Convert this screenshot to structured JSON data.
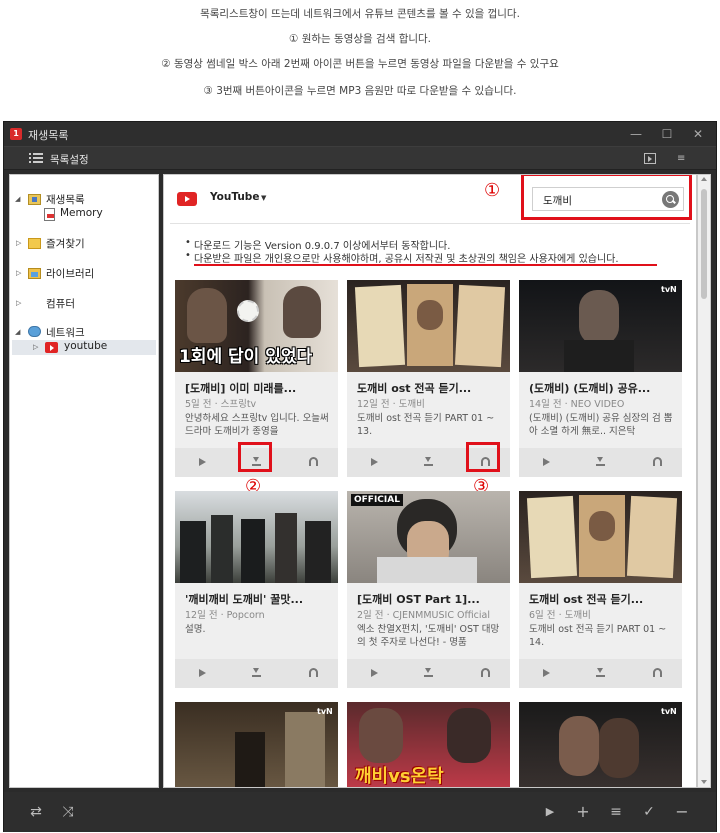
{
  "caption": {
    "line1": "목록리스트창이 뜨는데  네트워크에서 유튜브 콘텐츠를 볼 수 있을 껍니다.",
    "line2": "① 원하는 동영상을 검색 합니다.",
    "line3": "② 동영상 썸네일 박스 아래 2번째 아이콘 버튼을 누르면 동영상 파일을 다운받을 수 있구요",
    "line4": "③ 3번째 버튼아이콘을 누르면 MP3 음원만 따로 다운받을 수 있습니다."
  },
  "window": {
    "title": "재생목록"
  },
  "toolbar": {
    "list_settings": "목록설정"
  },
  "sidebar": {
    "playlist": "재생목록",
    "memory": "Memory",
    "favorites": "즐겨찾기",
    "library": "라이브러리",
    "computer": "컴퓨터",
    "network": "네트워크",
    "youtube": "youtube"
  },
  "source": {
    "label": "YouTube"
  },
  "search": {
    "value": "도깨비"
  },
  "notices": [
    "다운로드 기능은 Version 0.9.0.7 이상에서부터 동작합니다.",
    "다운받은 파일은 개인용으로만 사용해야하며, 공유시 저작권 및 초상권의 책임은 사용자에게 있습니다."
  ],
  "annotations": {
    "one": "①",
    "two": "②",
    "three": "③"
  },
  "videos": [
    {
      "title": "[도깨비] 이미 미래를...",
      "age": "5일 전",
      "channel": "스프링tv",
      "desc": "안녕하세요 스프링tv 입니다. 오늘써 드라마 도깨비가 종영을",
      "thumb_text": "1회에 답이 있었다"
    },
    {
      "title": "도깨비 ost 전곡 듣기...",
      "age": "12일 전",
      "channel": "도깨비",
      "desc": "도깨비 ost 전곡 듣기 PART 01 ~ 13.",
      "thumb_text": ""
    },
    {
      "title": "(도깨비) (도깨비) 공유...",
      "age": "14일 전",
      "channel": "NEO VIDEO",
      "desc": "(도깨비) (도깨비) 공유 심장의 검 뽑아 소멸 하게 無로.. 지은탁",
      "thumb_text": "tvN"
    },
    {
      "title": "'깨비깨비 도깨비' 꿀맛...",
      "age": "12일 전",
      "channel": "Popcorn",
      "desc": "설명.",
      "thumb_text": ""
    },
    {
      "title": "[도깨비 OST Part 1]...",
      "age": "2일 전",
      "channel": "CJENMMUSIC Official",
      "desc": "엑소 찬열X펀치, '도깨비' OST 대망의 첫 주자로 나선다! - 명품",
      "thumb_text": "OFFICIAL"
    },
    {
      "title": "도깨비 ost 전곡 듣기...",
      "age": "6일 전",
      "channel": "도깨비",
      "desc": "도깨비 ost 전곡 듣기 PART 01 ~ 14.",
      "thumb_text": ""
    },
    {
      "title": "",
      "age": "",
      "channel": "",
      "desc": "",
      "thumb_text": "tvN"
    },
    {
      "title": "",
      "age": "",
      "channel": "",
      "desc": "",
      "thumb_text": "깨비vs온탁"
    },
    {
      "title": "",
      "age": "",
      "channel": "",
      "desc": "",
      "thumb_text": "tvN"
    }
  ],
  "colors": {
    "accent_red": "#e0101a",
    "window_dark": "#2b2b2b",
    "youtube_red": "#e02424"
  }
}
